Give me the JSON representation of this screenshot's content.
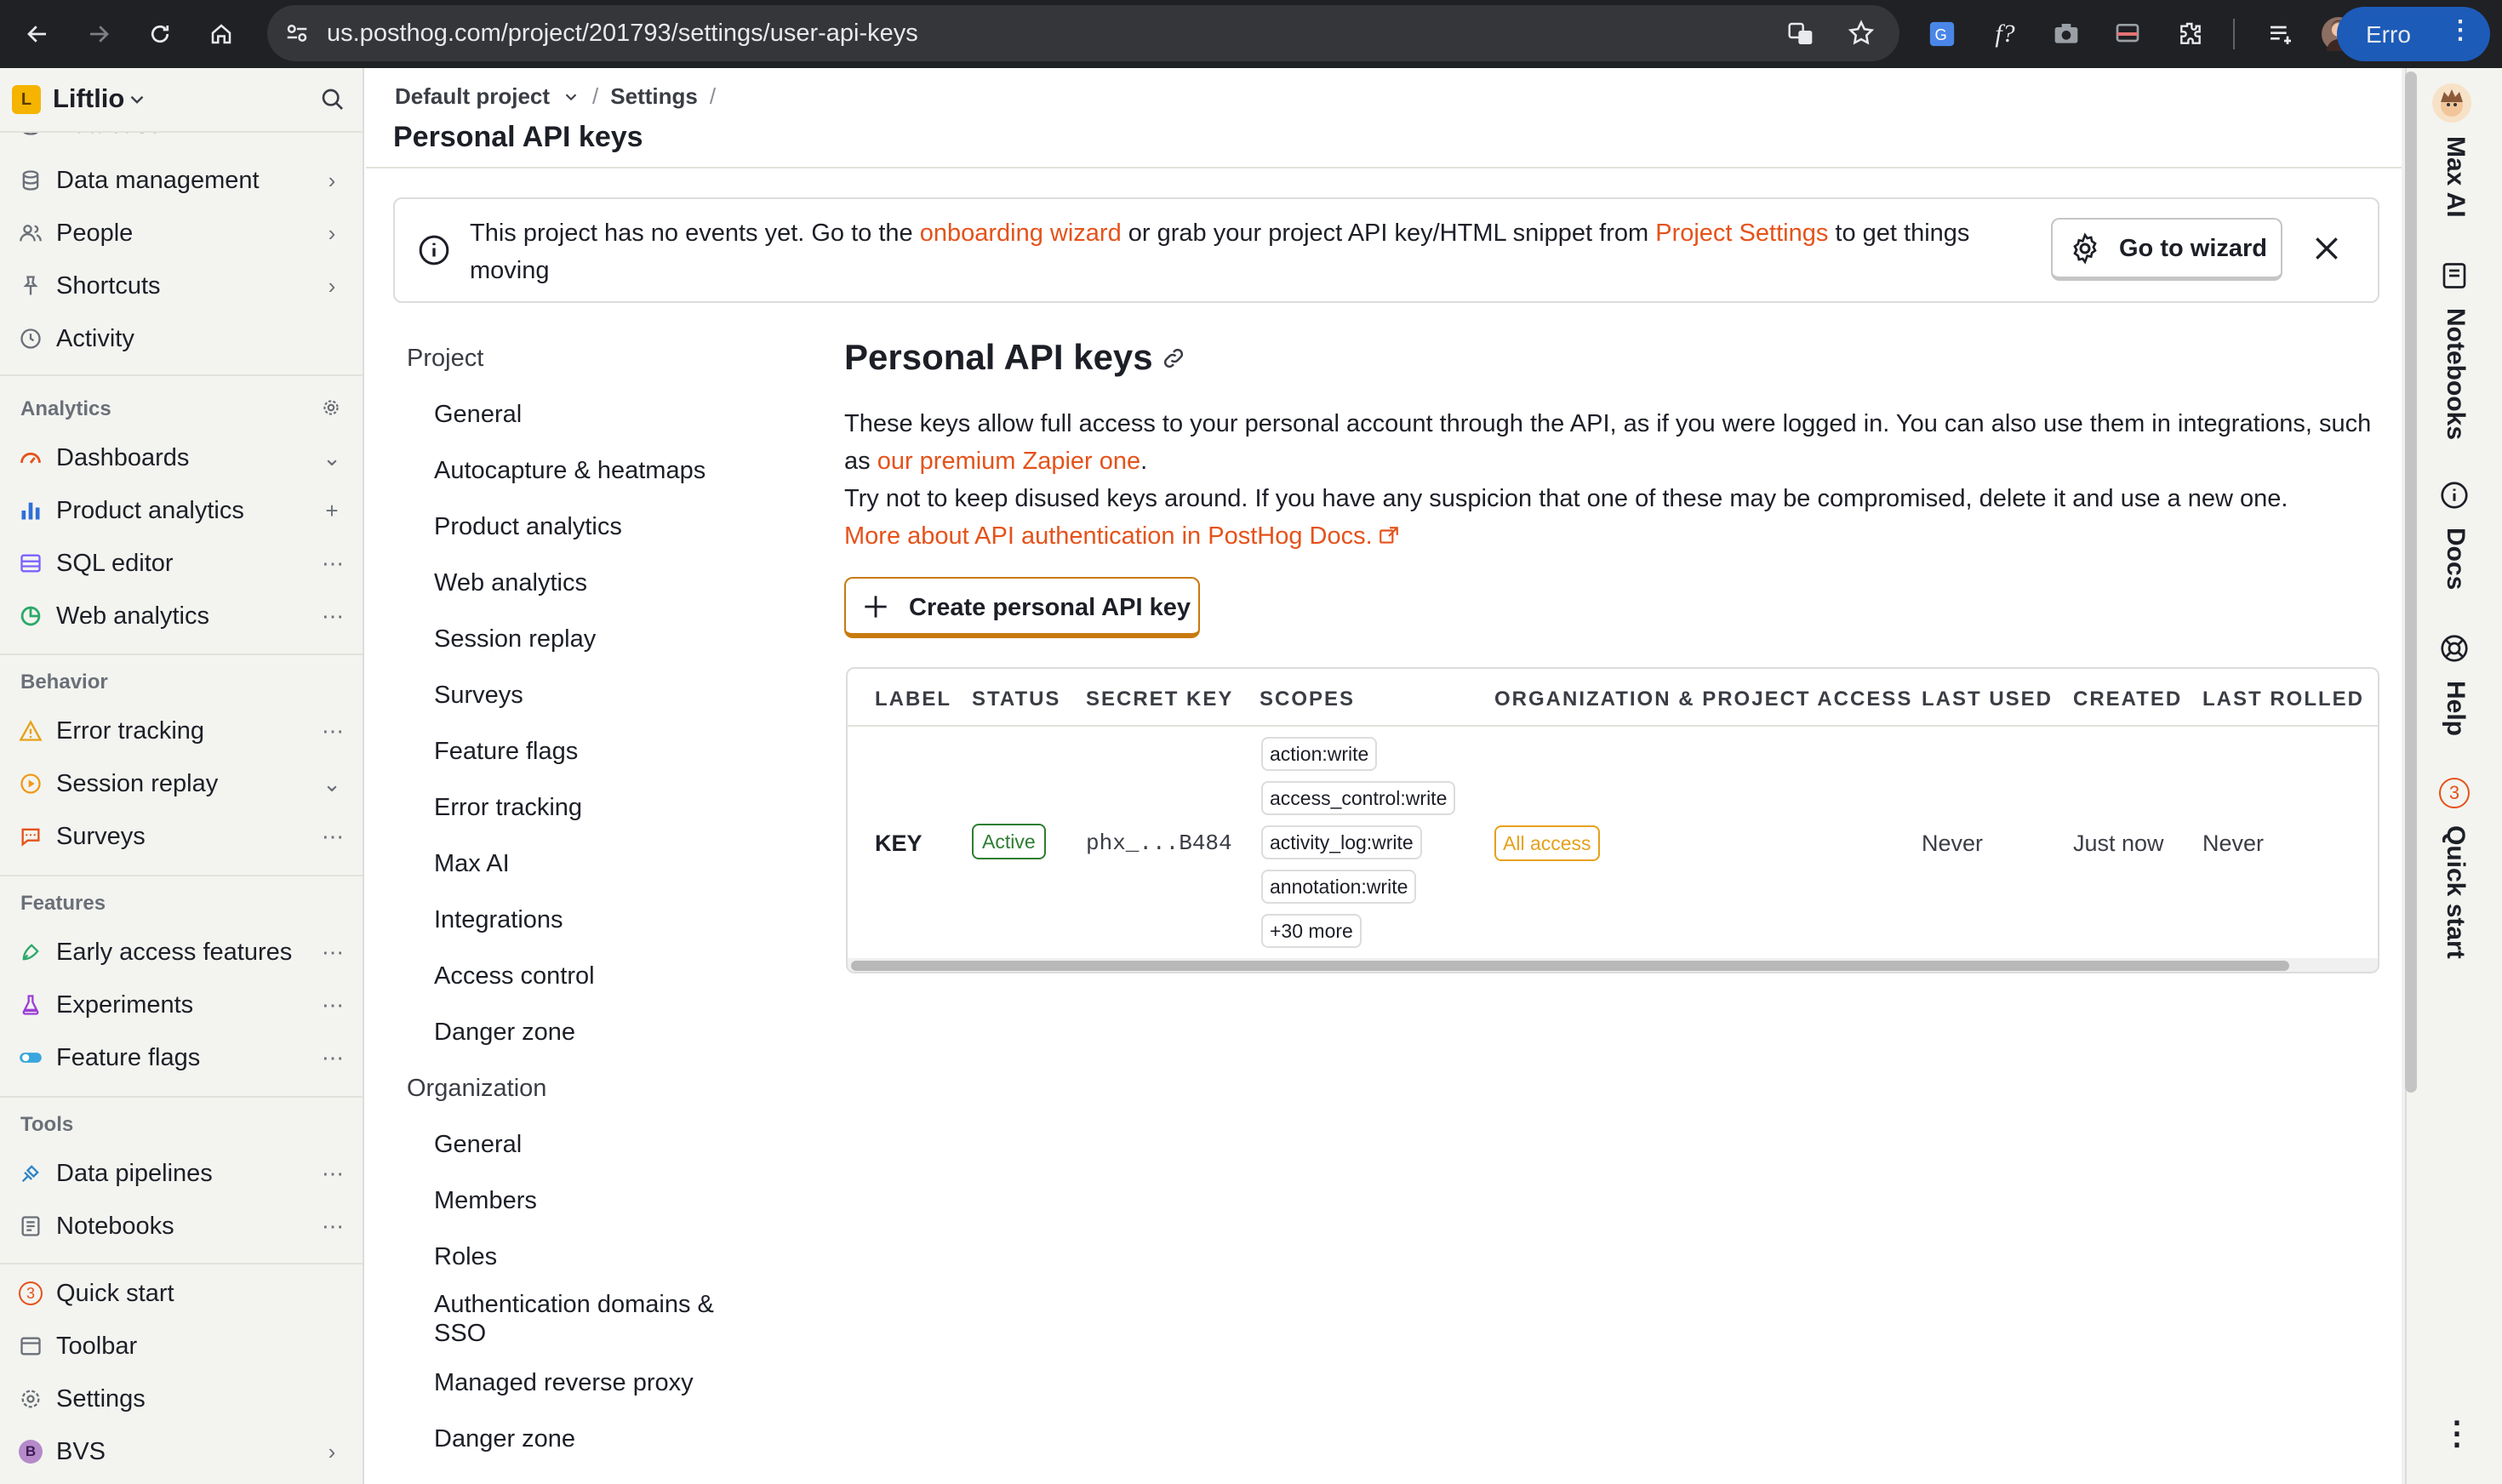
{
  "browser": {
    "url": "us.posthog.com/project/201793/settings/user-api-keys",
    "profile_label": "Erro"
  },
  "sidebar": {
    "org_name": "Liftlio",
    "org_initial": "L",
    "partial_item": "Database",
    "top_items": [
      {
        "label": "Data management"
      },
      {
        "label": "People"
      },
      {
        "label": "Shortcuts"
      },
      {
        "label": "Activity"
      }
    ],
    "analytics_header": "Analytics",
    "analytics_items": [
      {
        "label": "Dashboards"
      },
      {
        "label": "Product analytics"
      },
      {
        "label": "SQL editor"
      },
      {
        "label": "Web analytics"
      }
    ],
    "behavior_header": "Behavior",
    "behavior_items": [
      {
        "label": "Error tracking"
      },
      {
        "label": "Session replay"
      },
      {
        "label": "Surveys"
      }
    ],
    "features_header": "Features",
    "features_items": [
      {
        "label": "Early access features"
      },
      {
        "label": "Experiments"
      },
      {
        "label": "Feature flags"
      }
    ],
    "tools_header": "Tools",
    "tools_items": [
      {
        "label": "Data pipelines"
      },
      {
        "label": "Notebooks"
      }
    ],
    "bottom_items": [
      {
        "label": "Quick start",
        "badge": "3"
      },
      {
        "label": "Toolbar"
      },
      {
        "label": "Settings"
      },
      {
        "label": "BVS",
        "initial": "B"
      }
    ]
  },
  "header": {
    "breadcrumb_project": "Default project",
    "breadcrumb_settings": "Settings",
    "page_title": "Personal API keys"
  },
  "banner": {
    "text_1": "This project has no events yet. Go to the ",
    "link_1": "onboarding wizard",
    "text_2": " or grab your project API key/HTML snippet from ",
    "link_2": "Project Settings",
    "text_3": " to get things moving",
    "button": "Go to wizard"
  },
  "settings_nav": {
    "project_header": "Project",
    "project_items": [
      "General",
      "Autocapture & heatmaps",
      "Product analytics",
      "Web analytics",
      "Session replay",
      "Surveys",
      "Feature flags",
      "Error tracking",
      "Max AI",
      "Integrations",
      "Access control",
      "Danger zone"
    ],
    "org_header": "Organization",
    "org_items": [
      "General",
      "Members",
      "Roles",
      "Authentication domains & SSO",
      "Managed reverse proxy",
      "Danger zone"
    ]
  },
  "content": {
    "heading": "Personal API keys",
    "desc_1": "These keys allow full access to your personal account through the API, as if you were logged in. You can also use them in integrations, such as ",
    "desc_link": "our premium Zapier one",
    "desc_2": ".",
    "desc_3": "Try not to keep disused keys around. If you have any suspicion that one of these may be compromised, delete it and use a new one.",
    "docs_link": "More about API authentication in PostHog Docs.",
    "create_button": "Create personal API key"
  },
  "table": {
    "columns": [
      "LABEL",
      "STATUS",
      "SECRET KEY",
      "SCOPES",
      "ORGANIZATION & PROJECT ACCESS",
      "LAST USED",
      "CREATED",
      "LAST ROLLED"
    ],
    "row": {
      "label": "KEY",
      "status": "Active",
      "secret_key": "phx_...B484",
      "scopes": [
        "action:write",
        "access_control:write",
        "activity_log:write",
        "annotation:write",
        "+30 more"
      ],
      "access": "All access",
      "last_used": "Never",
      "created": "Just now",
      "last_rolled": "Never"
    }
  },
  "right_rail": {
    "items": [
      "Max AI",
      "Notebooks",
      "Docs",
      "Help",
      "Quick start"
    ],
    "quick_start_badge": "3"
  },
  "colors": {
    "accent": "#e5521a",
    "sidebar_bg": "#f3f4f0",
    "active_green": "#2e7d32",
    "warning": "#e6a11a"
  }
}
